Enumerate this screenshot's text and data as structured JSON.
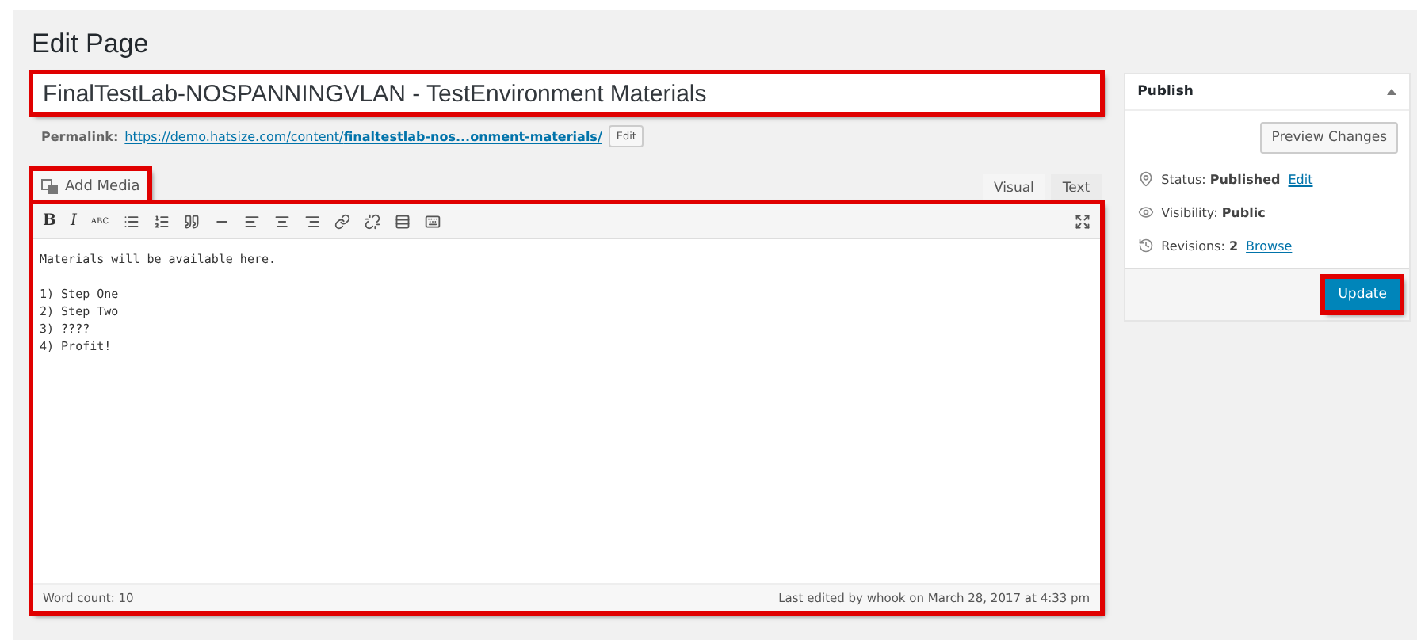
{
  "page_title": "Edit Page",
  "title_field": {
    "value": "FinalTestLab-NOSPANNINGVLAN - TestEnvironment Materials",
    "highlighted": true
  },
  "permalink": {
    "label": "Permalink:",
    "url_base": "https://demo.hatsize.com/content/",
    "slug": "finaltestlab-nos...onment-materials/",
    "edit_button": "Edit"
  },
  "add_media": {
    "label": "Add Media",
    "highlighted": true
  },
  "editor_tabs": [
    {
      "label": "Visual",
      "selected": true
    },
    {
      "label": "Text",
      "selected": false
    }
  ],
  "editor": {
    "highlighted": true,
    "toolbar_letters": [
      {
        "label": "B"
      },
      {
        "label": "I"
      },
      {
        "label": "ABC"
      }
    ],
    "paragraphs": [
      [
        "Materials will be available here."
      ],
      [
        "1) Step One",
        "2) Step Two",
        "3) ????",
        "4) Profit!"
      ]
    ],
    "word_count": "Word count: 10",
    "last_edited": "Last edited by whook on March 28, 2017 at 4:33 pm"
  },
  "publish": {
    "title": "Publish",
    "preview_button": "Preview Changes",
    "rows": [
      {
        "kind": "status",
        "label": "Status:",
        "value": "Published",
        "link": "Edit"
      },
      {
        "kind": "visibility",
        "label": "Visibility:",
        "value": "Public"
      },
      {
        "kind": "revisions",
        "label": "Revisions:",
        "value": "2",
        "link": "Browse"
      }
    ],
    "update_button": {
      "label": "Update",
      "highlighted": true
    }
  }
}
